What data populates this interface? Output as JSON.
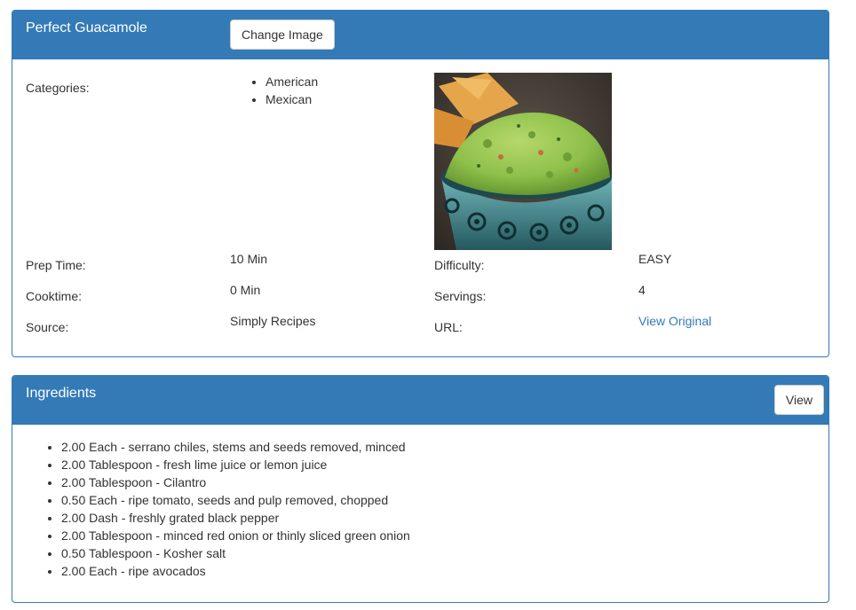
{
  "recipe": {
    "title": "Perfect Guacamole",
    "change_image_label": "Change Image",
    "categories_label": "Categories:",
    "categories": [
      "American",
      "Mexican"
    ],
    "image_alt": "guacamole-photo",
    "prep_time_label": "Prep Time:",
    "prep_time": "10 Min",
    "difficulty_label": "Difficulty:",
    "difficulty": "EASY",
    "cooktime_label": "Cooktime:",
    "cooktime": "0 Min",
    "servings_label": "Servings:",
    "servings": "4",
    "source_label": "Source:",
    "source": "Simply Recipes",
    "url_label": "URL:",
    "url_link": "View Original"
  },
  "ingredients": {
    "title": "Ingredients",
    "view_label": "View",
    "items": [
      "2.00 Each - serrano chiles, stems and seeds removed, minced",
      "2.00 Tablespoon - fresh lime juice or lemon juice",
      "2.00 Tablespoon - Cilantro",
      "0.50 Each - ripe tomato, seeds and pulp removed, chopped",
      "2.00 Dash - freshly grated black pepper",
      "2.00 Tablespoon - minced red onion or thinly sliced green onion",
      "0.50 Tablespoon - Kosher salt",
      "2.00 Each - ripe avocados"
    ]
  },
  "colors": {
    "primary": "#337ab7",
    "text": "#333333",
    "link": "#337ab7"
  }
}
